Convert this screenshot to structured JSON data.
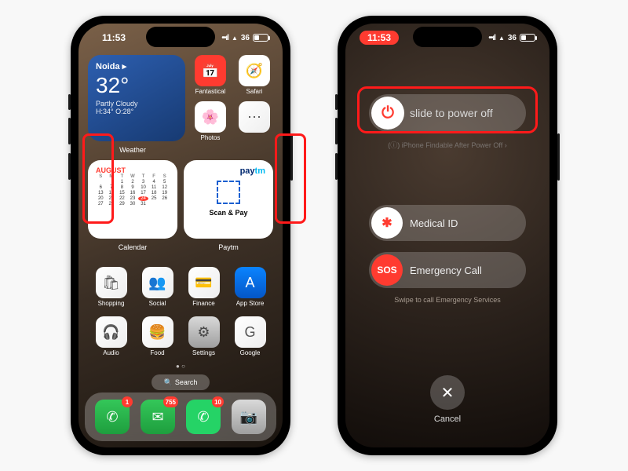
{
  "status": {
    "time": "11:53",
    "battery_pct": "36"
  },
  "left": {
    "weather": {
      "location": "Noida",
      "temp": "32°",
      "cond": "Partly Cloudy",
      "hi_lo": "H:34° O:28°",
      "caption": "Weather"
    },
    "top_apps": [
      {
        "label": "Fantastical",
        "color": "bg-red",
        "glyph": "📅"
      },
      {
        "label": "Safari",
        "color": "bg-white",
        "glyph": "🧭"
      },
      {
        "label": "Photos",
        "color": "bg-white",
        "glyph": "🌸"
      },
      {
        "label": "",
        "color": "bg-mix",
        "glyph": "⋯"
      }
    ],
    "calendar": {
      "month": "AUGUST",
      "dow": [
        "S",
        "M",
        "T",
        "W",
        "T",
        "F",
        "S"
      ],
      "days": [
        "",
        "",
        "1",
        "2",
        "3",
        "4",
        "5",
        "6",
        "7",
        "8",
        "9",
        "10",
        "11",
        "12",
        "13",
        "14",
        "15",
        "16",
        "17",
        "18",
        "19",
        "20",
        "21",
        "22",
        "23",
        "24",
        "25",
        "26",
        "27",
        "28",
        "29",
        "30",
        "31"
      ],
      "today": "24",
      "caption": "Calendar"
    },
    "paytm": {
      "logo_a": "pay",
      "logo_b": "tm",
      "scan": "Scan & Pay",
      "caption": "Paytm"
    },
    "row1": [
      {
        "label": "Shopping",
        "color": "bg-mix",
        "glyph": "🛍"
      },
      {
        "label": "Social",
        "color": "bg-mix",
        "glyph": "👥"
      },
      {
        "label": "Finance",
        "color": "bg-mix",
        "glyph": "💳"
      },
      {
        "label": "App Store",
        "color": "bg-blue",
        "glyph": "A"
      }
    ],
    "row2": [
      {
        "label": "Audio",
        "color": "bg-mix",
        "glyph": "🎧"
      },
      {
        "label": "Food",
        "color": "bg-mix",
        "glyph": "🍔"
      },
      {
        "label": "Settings",
        "color": "bg-grey",
        "glyph": "⚙"
      },
      {
        "label": "Google",
        "color": "bg-mix",
        "glyph": "G"
      }
    ],
    "search": "Search",
    "dock": [
      {
        "name": "phone",
        "color": "bg-green",
        "glyph": "✆",
        "badge": "1"
      },
      {
        "name": "messages",
        "color": "bg-green",
        "glyph": "✉",
        "badge": "755"
      },
      {
        "name": "whatsapp",
        "color": "bg-whats",
        "glyph": "✆",
        "badge": "10"
      },
      {
        "name": "camera",
        "color": "bg-grey",
        "glyph": "📷",
        "badge": ""
      }
    ]
  },
  "right": {
    "power_slider": "slide to power off",
    "findable": "iPhone Findable After Power Off",
    "medical": "Medical ID",
    "sos": "Emergency Call",
    "sos_knob": "SOS",
    "swipe_note": "Swipe to call Emergency Services",
    "cancel": "Cancel"
  }
}
